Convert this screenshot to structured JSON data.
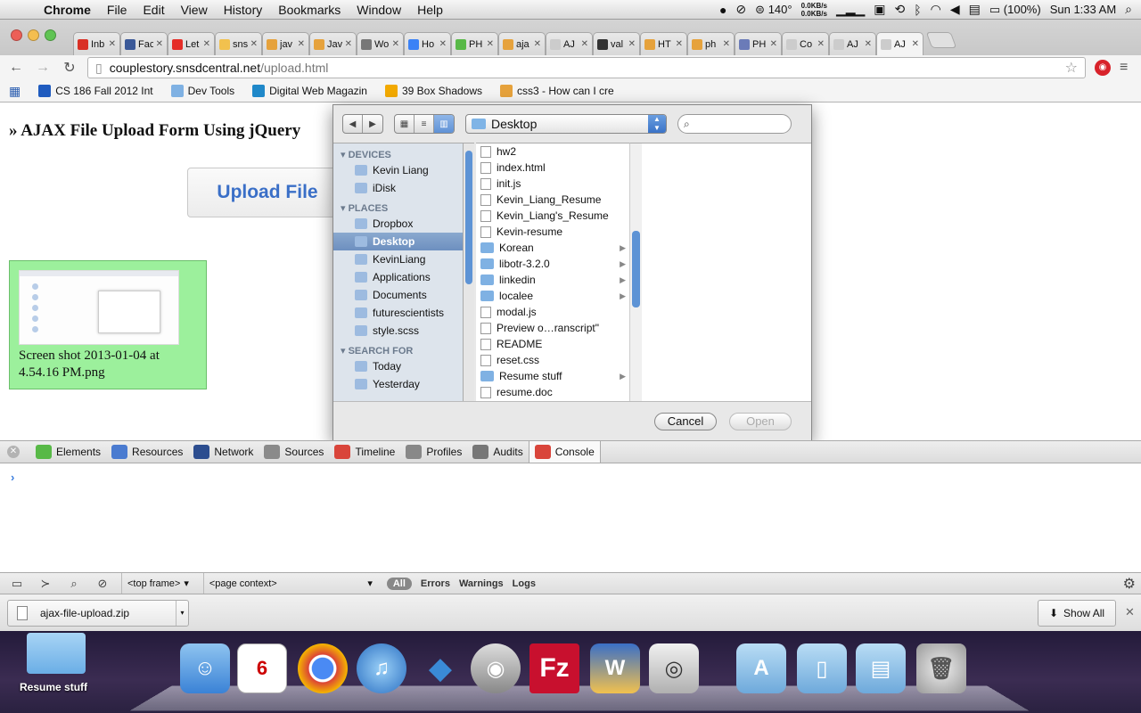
{
  "menubar": {
    "app": "Chrome",
    "items": [
      "File",
      "Edit",
      "View",
      "History",
      "Bookmarks",
      "Window",
      "Help"
    ],
    "temp": "140°",
    "net_up": "0.0KB/s",
    "net_down": "0.0KB/s",
    "battery": "(100%)",
    "clock": "Sun 1:33 AM"
  },
  "tabs": [
    {
      "title": "Inb",
      "color": "#d93025"
    },
    {
      "title": "Fac",
      "color": "#3b5998"
    },
    {
      "title": "Let",
      "color": "#e52d27"
    },
    {
      "title": "sns",
      "color": "#f2c14e"
    },
    {
      "title": "jav",
      "color": "#e6a23c"
    },
    {
      "title": "Jav",
      "color": "#e6a23c"
    },
    {
      "title": "Wo",
      "color": "#777777"
    },
    {
      "title": "Ho",
      "color": "#3b82f6"
    },
    {
      "title": "PH",
      "color": "#58b947"
    },
    {
      "title": "aja",
      "color": "#e6a23c"
    },
    {
      "title": "AJ",
      "color": "#cccccc"
    },
    {
      "title": "val",
      "color": "#333333"
    },
    {
      "title": "HT",
      "color": "#e6a23c"
    },
    {
      "title": "ph",
      "color": "#e6a23c"
    },
    {
      "title": "PH",
      "color": "#6b7bb8"
    },
    {
      "title": "Co",
      "color": "#cccccc"
    },
    {
      "title": "AJ",
      "color": "#cccccc"
    },
    {
      "title": "AJ",
      "color": "#cccccc"
    }
  ],
  "address": {
    "host": "couplestory.snsdcentral.net",
    "path": "/upload.html"
  },
  "bookmarks": [
    {
      "label": "CS 186 Fall 2012 Int",
      "color": "#1f5bbf"
    },
    {
      "label": "Dev Tools",
      "color": "#7fb1e3"
    },
    {
      "label": "Digital Web Magazin",
      "color": "#1f88c9"
    },
    {
      "label": "39 Box Shadows",
      "color": "#f2a900"
    },
    {
      "label": "css3 - How can I cre",
      "color": "#e6a23c"
    }
  ],
  "page": {
    "heading": "» AJAX File Upload Form Using jQuery",
    "upload_label": "Upload File",
    "thumb_caption": "Screen shot 2013-01-04 at 4.54.16 PM.png"
  },
  "dialog": {
    "location": "Desktop",
    "search_placeholder": "",
    "sidebar": [
      {
        "section": "DEVICES",
        "items": [
          "Kevin Liang",
          "iDisk"
        ]
      },
      {
        "section": "PLACES",
        "items": [
          "Dropbox",
          "Desktop",
          "KevinLiang",
          "Applications",
          "Documents",
          "futurescientists",
          "style.scss"
        ]
      },
      {
        "section": "SEARCH FOR",
        "items": [
          "Today",
          "Yesterday"
        ]
      }
    ],
    "selected_sidebar": "Desktop",
    "files": [
      {
        "name": "hw2",
        "folder": false
      },
      {
        "name": "index.html",
        "folder": false
      },
      {
        "name": "init.js",
        "folder": false
      },
      {
        "name": "Kevin_Liang_Resume",
        "folder": false
      },
      {
        "name": "Kevin_Liang's_Resume",
        "folder": false
      },
      {
        "name": "Kevin-resume",
        "folder": false
      },
      {
        "name": "Korean",
        "folder": true
      },
      {
        "name": "libotr-3.2.0",
        "folder": true
      },
      {
        "name": "linkedin",
        "folder": true
      },
      {
        "name": "localee",
        "folder": true
      },
      {
        "name": "modal.js",
        "folder": false
      },
      {
        "name": "Preview o…ranscript\"",
        "folder": false
      },
      {
        "name": "README",
        "folder": false
      },
      {
        "name": "reset.css",
        "folder": false
      },
      {
        "name": "Resume stuff",
        "folder": true
      },
      {
        "name": "resume.doc",
        "folder": false
      }
    ],
    "cancel_label": "Cancel",
    "open_label": "Open"
  },
  "devtools": {
    "tabs": [
      {
        "label": "Elements",
        "color": "#58b947"
      },
      {
        "label": "Resources",
        "color": "#4a7bd0"
      },
      {
        "label": "Network",
        "color": "#2c4d8f"
      },
      {
        "label": "Sources",
        "color": "#8a8a8a"
      },
      {
        "label": "Timeline",
        "color": "#d9453b"
      },
      {
        "label": "Profiles",
        "color": "#888888"
      },
      {
        "label": "Audits",
        "color": "#777777"
      },
      {
        "label": "Console",
        "color": "#d9453b"
      }
    ],
    "active_tab": "Console",
    "prompt": "›",
    "frame_select": "<top frame>",
    "context_select": "<page context>",
    "filters": [
      "All",
      "Errors",
      "Warnings",
      "Logs"
    ]
  },
  "downloads": {
    "file": "ajax-file-upload.zip",
    "show_all": "Show All"
  },
  "desktop": {
    "folder_label": "Resume stuff"
  }
}
